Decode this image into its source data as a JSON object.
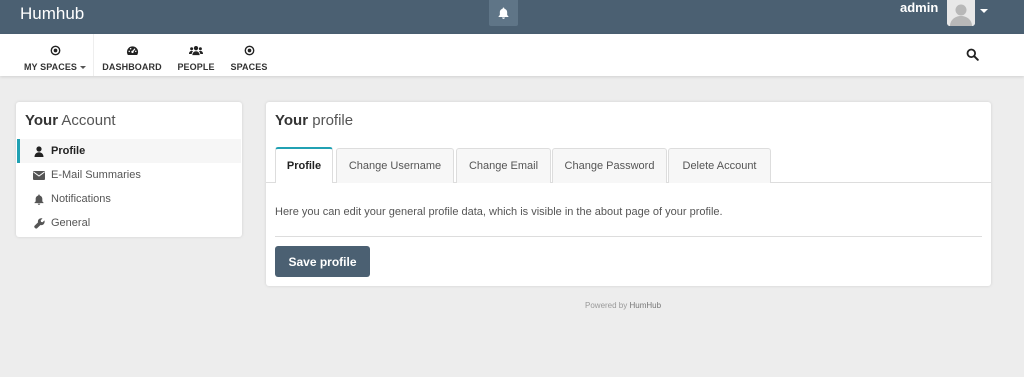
{
  "app": {
    "brand": "Humhub",
    "user_name": "admin"
  },
  "colors": {
    "topbar": "#4b6072",
    "accent": "#21a1b3",
    "primary_button": "#4b6072",
    "page_background": "#ededed"
  },
  "icons": {
    "notifications": "bell-icon",
    "avatar": "user-avatar",
    "search": "search-icon"
  },
  "nav": {
    "items": [
      {
        "label": "MY SPACES",
        "icon": "dot-circle-icon",
        "has_dropdown": true
      },
      {
        "label": "DASHBOARD",
        "icon": "tachometer-icon"
      },
      {
        "label": "PEOPLE",
        "icon": "users-icon"
      },
      {
        "label": "SPACES",
        "icon": "dot-circle-icon"
      }
    ]
  },
  "sidebar": {
    "title_bold": "Your",
    "title_rest": " Account",
    "items": [
      {
        "label": "Profile",
        "icon": "user-icon",
        "active": true
      },
      {
        "label": "E-Mail Summaries",
        "icon": "envelope-icon"
      },
      {
        "label": "Notifications",
        "icon": "bell-icon"
      },
      {
        "label": "General",
        "icon": "wrench-icon"
      }
    ]
  },
  "main": {
    "title_bold": "Your",
    "title_rest": " profile",
    "tabs": [
      {
        "label": "Profile",
        "active": true
      },
      {
        "label": "Change Username"
      },
      {
        "label": "Change Email"
      },
      {
        "label": "Change Password"
      },
      {
        "label": "Delete Account"
      }
    ],
    "description": "Here you can edit your general profile data, which is visible in the about page of your profile.",
    "save_label": "Save profile"
  },
  "footer": {
    "prefix": "Powered by ",
    "brand": "HumHub"
  }
}
